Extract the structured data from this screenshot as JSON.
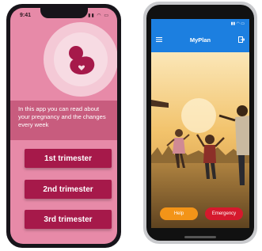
{
  "left_phone": {
    "status": {
      "time": "9:41",
      "icons": "▮▮ ◠ ▭"
    },
    "intro_text": "In this app you can read about your pregnancy  and the changes every week",
    "buttons": [
      {
        "label": "1st trimester"
      },
      {
        "label": "2nd trimester"
      },
      {
        "label": "3rd trimester"
      }
    ],
    "colors": {
      "background": "#e78aa8",
      "band": "#c85c7e",
      "button": "#a6194a"
    },
    "icons": {
      "hero": "pregnancy-icon"
    }
  },
  "right_phone": {
    "status": {
      "icons": "▮▮ ◠ ▭"
    },
    "header": {
      "title": "MyPlan"
    },
    "icons": {
      "menu": "hamburger-menu-icon",
      "exit": "exit-icon"
    },
    "buttons": {
      "help": "Help",
      "emergency": "Emergency"
    },
    "colors": {
      "header": "#1c7fe0",
      "help": "#f39418",
      "emergency": "#d5192d"
    }
  }
}
